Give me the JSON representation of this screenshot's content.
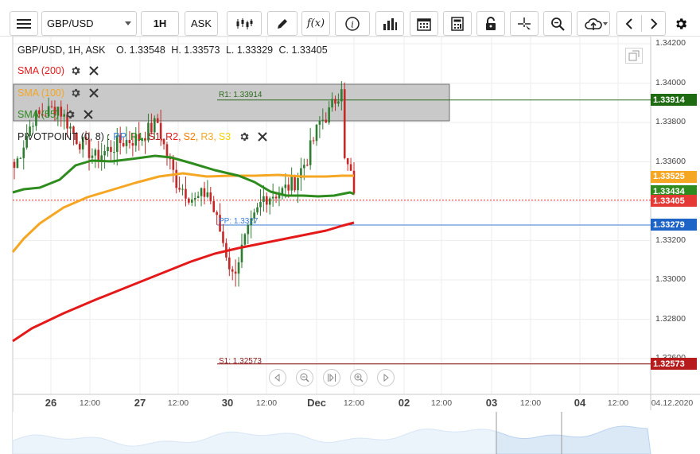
{
  "toolbar": {
    "symbol": "GBP/USD",
    "timeframe": "1H",
    "price_type": "ASK",
    "icons": [
      "menu-icon",
      "candlestick-icon",
      "draw-pencil-icon",
      "function-icon",
      "info-icon",
      "bar-chart-icon",
      "calendar-icon",
      "calculator-icon",
      "lock-icon",
      "crosshair-icon",
      "zoom-icon",
      "cloud-upload-icon",
      "arrow-left-icon",
      "arrow-right-icon",
      "settings-icon"
    ]
  },
  "header": {
    "title": "GBP/USD, 1H, ASK",
    "open": "O. 1.33548",
    "high": "H. 1.33573",
    "low": "L. 1.33329",
    "close": "C. 1.33405"
  },
  "indicators": [
    {
      "label": "SMA (200)",
      "color": "#e41a1a"
    },
    {
      "label": "SMA (100)",
      "color": "#f5a623"
    },
    {
      "label": "SMA (55)",
      "color": "#2e8b1e"
    }
  ],
  "pivot": {
    "label": "PIVOTPOINT",
    "params": "(0, 8)",
    "colon": ":",
    "levels": [
      {
        "name": "PP",
        "color": "#3a7bd5"
      },
      {
        "name": "R1",
        "color": "#2e8b1e"
      },
      {
        "name": "S1",
        "color": "#b71c1c"
      },
      {
        "name": "R2",
        "color": "#e41a1a"
      },
      {
        "name": "S2",
        "color": "#f57c00"
      },
      {
        "name": "R3",
        "color": "#f5a623"
      },
      {
        "name": "S3",
        "color": "#f2d200"
      }
    ],
    "r1_label": "R1: 1.33914",
    "pp_label": "PP: 1.3327",
    "s1_label": "S1: 1.32573"
  },
  "y_axis": {
    "labels": [
      "1.34200",
      "1.34000",
      "1.33800",
      "1.33600",
      "1.33400",
      "1.33200",
      "1.33000",
      "1.32800",
      "1.32600"
    ],
    "range": [
      1.325,
      1.342
    ]
  },
  "x_axis": [
    {
      "text": "26",
      "major": true
    },
    {
      "text": "12:00",
      "major": false
    },
    {
      "text": "27",
      "major": true
    },
    {
      "text": "12:00",
      "major": false
    },
    {
      "text": "30",
      "major": true
    },
    {
      "text": "12:00",
      "major": false
    },
    {
      "text": "Dec",
      "major": true
    },
    {
      "text": "12:00",
      "major": false
    },
    {
      "text": "02",
      "major": true
    },
    {
      "text": "12:00",
      "major": false
    },
    {
      "text": "03",
      "major": true
    },
    {
      "text": "12:00",
      "major": false
    },
    {
      "text": "04",
      "major": true
    },
    {
      "text": "12:00",
      "major": false
    },
    {
      "text": "04.12.2020",
      "major": false
    }
  ],
  "price_tags": [
    {
      "value": "1.33914",
      "color": "#1e6b12"
    },
    {
      "value": "1.33525",
      "color": "#f5a623"
    },
    {
      "value": "1.33434",
      "color": "#2e8b1e"
    },
    {
      "value": "1.33405",
      "color": "#e53935"
    },
    {
      "value": "1.33279",
      "color": "#1e63c6"
    },
    {
      "value": "1.32573",
      "color": "#b71c1c"
    }
  ],
  "nav_buttons": [
    "scroll-left-icon",
    "zoom-out-icon",
    "reset-zoom-icon",
    "zoom-in-icon",
    "scroll-right-icon"
  ],
  "colors": {
    "up_candle": "#2e7d32",
    "down_candle": "#c62828",
    "sma200": "#e41a1a",
    "sma100": "#f5a623",
    "sma55": "#2e8b1e",
    "r1_line": "#2e6b1e",
    "pp_line": "#3a7bd5",
    "s1_line": "#8b1a1a",
    "current_price_line": "#e53935"
  }
}
